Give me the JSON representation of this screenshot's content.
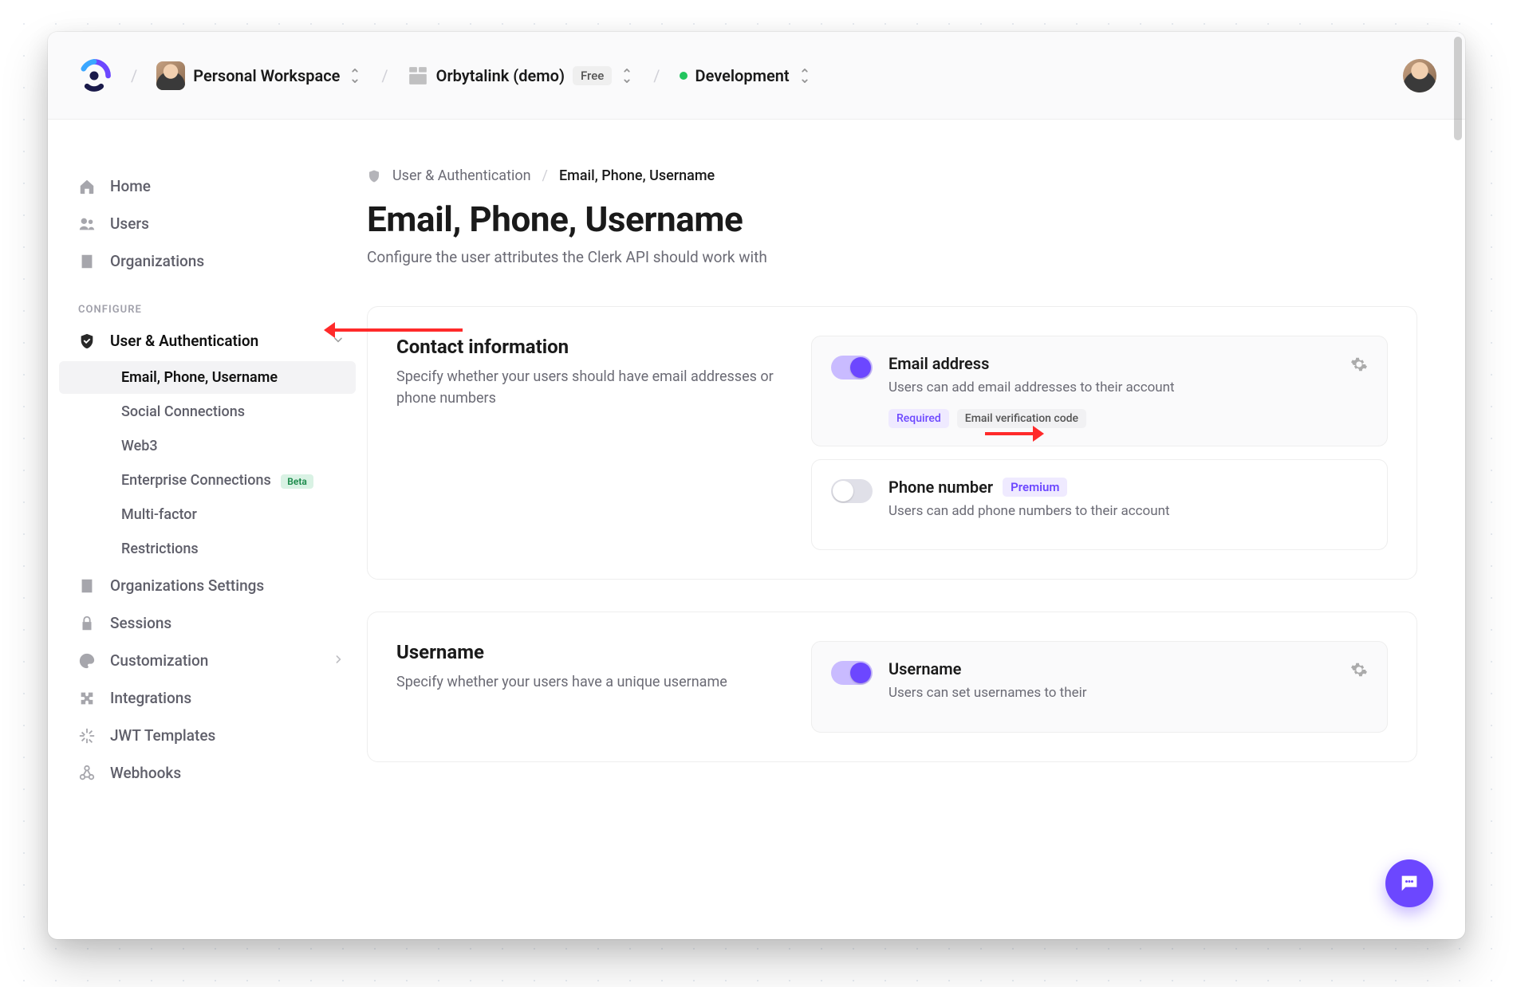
{
  "header": {
    "workspace": "Personal Workspace",
    "app_name": "Orbytalink (demo)",
    "plan_badge": "Free",
    "environment": "Development"
  },
  "sidebar": {
    "items": {
      "home": "Home",
      "users": "Users",
      "organizations": "Organizations"
    },
    "section_configure": "CONFIGURE",
    "user_auth": {
      "label": "User & Authentication",
      "sub": {
        "epu": "Email, Phone, Username",
        "social": "Social Connections",
        "web3": "Web3",
        "enterprise": "Enterprise Connections",
        "enterprise_tag": "Beta",
        "mfa": "Multi-factor",
        "restrictions": "Restrictions"
      }
    },
    "org_settings": "Organizations Settings",
    "sessions": "Sessions",
    "customization": "Customization",
    "integrations": "Integrations",
    "jwt": "JWT Templates",
    "webhooks": "Webhooks"
  },
  "breadcrumb": {
    "section": "User & Authentication",
    "current": "Email, Phone, Username"
  },
  "page": {
    "title": "Email, Phone, Username",
    "subtitle": "Configure the user attributes the Clerk API should work with"
  },
  "panels": {
    "contact": {
      "title": "Contact information",
      "desc": "Specify whether your users should have email addresses or phone numbers",
      "cards": {
        "email": {
          "title": "Email address",
          "desc": "Users can add email addresses to their account",
          "chip_required": "Required",
          "chip_verify": "Email verification code"
        },
        "phone": {
          "title": "Phone number",
          "premium": "Premium",
          "desc": "Users can add phone numbers to their account"
        }
      }
    },
    "username": {
      "title": "Username",
      "desc": "Specify whether your users have a unique username",
      "cards": {
        "username": {
          "title": "Username",
          "desc": "Users can set usernames to their"
        }
      }
    }
  }
}
